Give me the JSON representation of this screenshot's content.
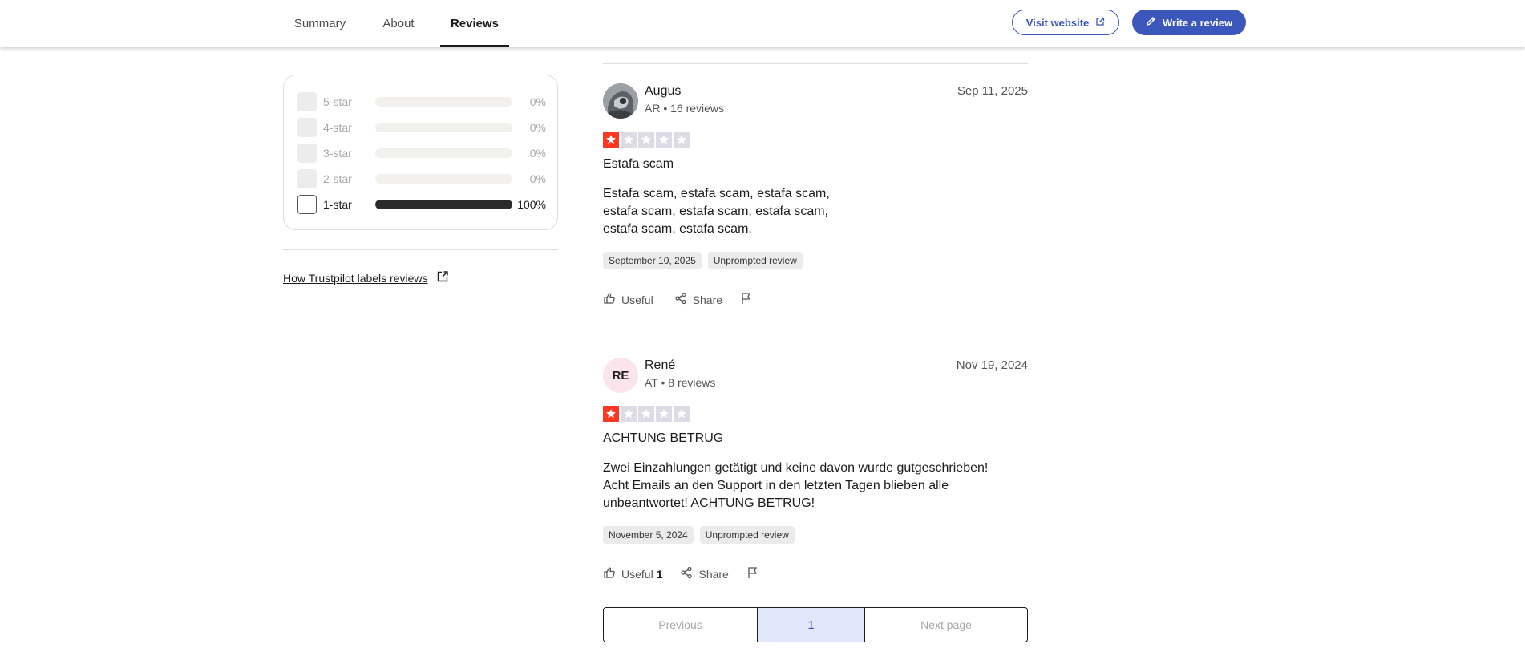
{
  "nav": {
    "tabs": [
      {
        "label": "Summary"
      },
      {
        "label": "About"
      },
      {
        "label": "Reviews",
        "active": true
      }
    ],
    "visit_label": "Visit website",
    "write_label": "Write a review",
    "accent": "#3c57bc"
  },
  "filter": {
    "rows": [
      {
        "label": "5-star",
        "percent": "0%",
        "fraction": 0,
        "enabled": false
      },
      {
        "label": "4-star",
        "percent": "0%",
        "fraction": 0,
        "enabled": false
      },
      {
        "label": "3-star",
        "percent": "0%",
        "fraction": 0,
        "enabled": false
      },
      {
        "label": "2-star",
        "percent": "0%",
        "fraction": 0,
        "enabled": false
      },
      {
        "label": "1-star",
        "percent": "100%",
        "fraction": 1,
        "enabled": true
      }
    ],
    "labels_link": "How Trustpilot labels reviews"
  },
  "reviews": [
    {
      "name": "Augus",
      "meta": "AR • 16 reviews",
      "date": "Sep 11, 2025",
      "rating": 1,
      "title": "Estafa scam",
      "body_lines": [
        "Estafa scam, estafa scam, estafa scam,",
        "estafa scam, estafa scam, estafa scam,",
        "estafa scam, estafa scam."
      ],
      "tags": [
        "September 10, 2025",
        "Unprompted review"
      ],
      "useful_label": "Useful",
      "useful_count": "",
      "share_label": "Share"
    },
    {
      "name": "René",
      "initials": "RE",
      "meta": "AT • 8 reviews",
      "date": "Nov 19, 2024",
      "rating": 1,
      "title": "ACHTUNG BETRUG",
      "body_lines": [
        "Zwei Einzahlungen getätigt und keine davon wurde gutgeschrieben!",
        "Acht Emails an den Support in den letzten Tagen blieben alle",
        "unbeantwortet! ACHTUNG BETRUG!"
      ],
      "tags": [
        "November 5, 2024",
        "Unprompted review"
      ],
      "useful_label": "Useful",
      "useful_count": "1",
      "share_label": "Share"
    }
  ],
  "pagination": {
    "prev_label": "Previous",
    "current": "1",
    "next_label": "Next page"
  },
  "colors": {
    "star_on": "#ff3722",
    "star_off": "#dcdce6"
  }
}
